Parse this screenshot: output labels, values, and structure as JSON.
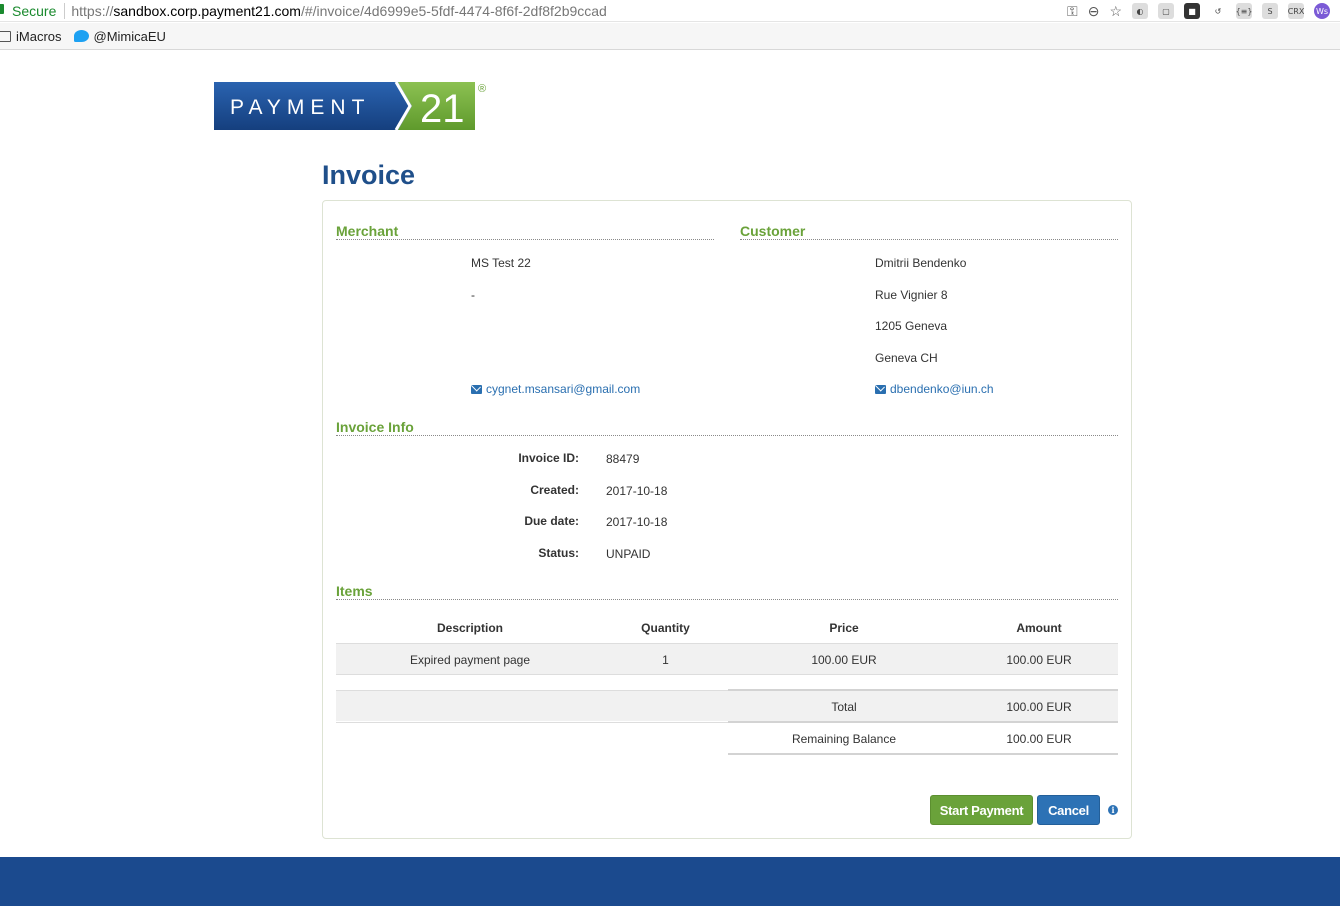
{
  "browser": {
    "secure_label": "Secure",
    "url_proto": "https://",
    "url_host": "sandbox.corp.payment21.com",
    "url_path": "/#/invoice/4d6999e5-5fdf-4474-8f6f-2df8f2b9ccad",
    "extensions": [
      "{≡}",
      "S",
      "CRX",
      "Ws"
    ],
    "bookmarks": [
      {
        "label": "iMacros",
        "icon": "folder-icon"
      },
      {
        "label": "@MimicaEU",
        "icon": "twitter-bird-icon"
      }
    ]
  },
  "logo": {
    "word": "PAYMENT",
    "number": "21",
    "reg": "®"
  },
  "page": {
    "title": "Invoice"
  },
  "merchant": {
    "heading": "Merchant",
    "name": "MS Test 22",
    "address": "-",
    "email": "cygnet.msansari@gmail.com"
  },
  "customer": {
    "heading": "Customer",
    "name": "Dmitrii Bendenko",
    "street": "Rue Vignier 8",
    "city": "1205 Geneva",
    "country": "Geneva CH",
    "email": "dbendenko@iun.ch"
  },
  "invoice_info": {
    "heading": "Invoice Info",
    "fields": [
      {
        "label": "Invoice ID:",
        "value": "88479"
      },
      {
        "label": "Created:",
        "value": "2017-10-18"
      },
      {
        "label": "Due date:",
        "value": "2017-10-18"
      },
      {
        "label": "Status:",
        "value": "UNPAID"
      }
    ]
  },
  "items": {
    "heading": "Items",
    "columns": [
      "Description",
      "Quantity",
      "Price",
      "Amount"
    ],
    "rows": [
      {
        "description": "Expired payment page",
        "quantity": "1",
        "price": "100.00 EUR",
        "amount": "100.00 EUR"
      }
    ],
    "total_label": "Total",
    "total_value": "100.00 EUR",
    "balance_label": "Remaining Balance",
    "balance_value": "100.00 EUR"
  },
  "actions": {
    "start_label": "Start Payment",
    "cancel_label": "Cancel"
  },
  "colors": {
    "brand_blue": "#1f4f8a",
    "brand_green": "#6aa23a",
    "footer": "#1b4a8e"
  }
}
